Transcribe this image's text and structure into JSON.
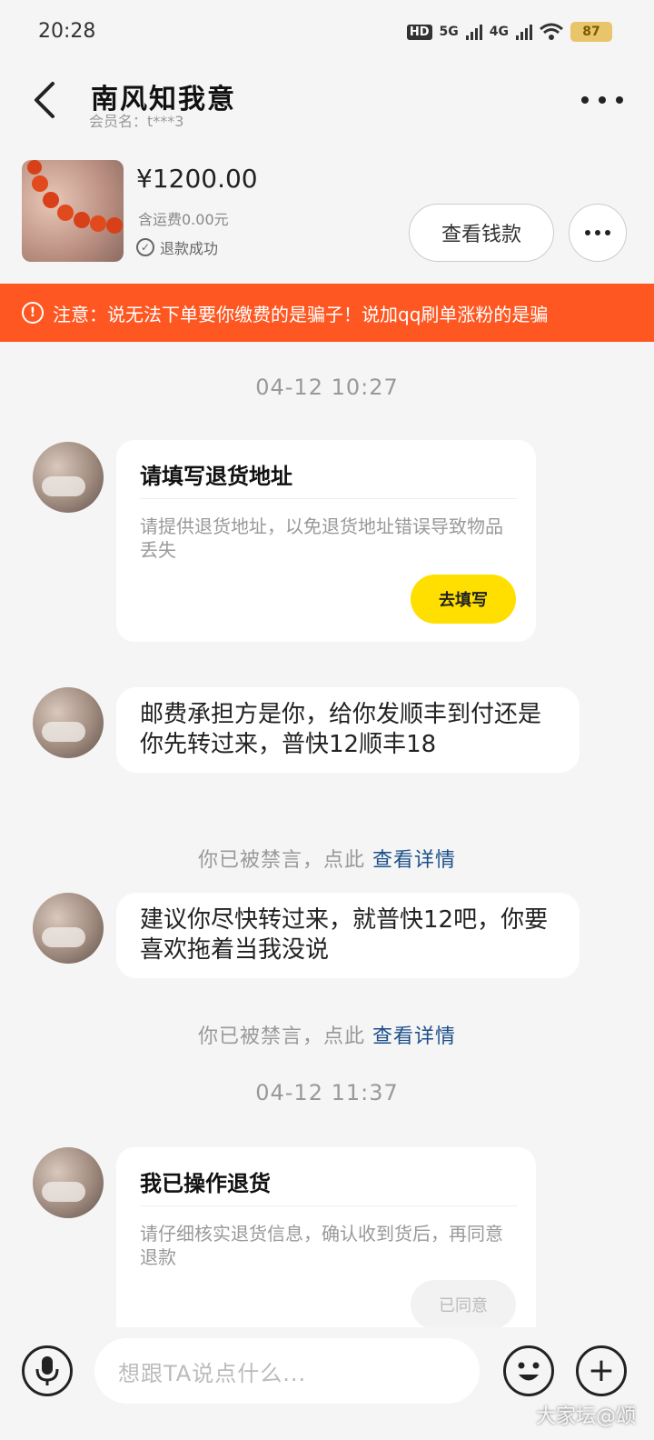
{
  "status_bar": {
    "time": "20:28",
    "hd": "HD",
    "net1": "5G",
    "net2": "4G",
    "battery": "87"
  },
  "header": {
    "title": "南风知我意",
    "member": "会员名：t***3"
  },
  "order": {
    "price": "¥1200.00",
    "shipping": "含运费0.00元",
    "status": "退款成功",
    "view_money_label": "查看钱款"
  },
  "warning": {
    "text": "注意：说无法下单要你缴费的是骗子！说加qq刷单涨粉的是骗"
  },
  "messages": {
    "time1": "04-12 10:27",
    "card1": {
      "title": "请填写退货地址",
      "desc": "请提供退货地址，以免退货地址错误导致物品丢失",
      "button": "去填写"
    },
    "msg1": "邮费承担方是你，给你发顺丰到付还是你先转过来，普快12顺丰18",
    "muted1": {
      "text": "你已被禁言，点此",
      "link": "查看详情"
    },
    "msg2": "建议你尽快转过来，就普快12吧，你要喜欢拖着当我没说",
    "muted2": {
      "text": "你已被禁言，点此",
      "link": "查看详情"
    },
    "time2": "04-12 11:37",
    "card2": {
      "title": "我已操作退货",
      "desc": "请仔细核实退货信息，确认收到货后，再同意退款",
      "button": "已同意"
    }
  },
  "input": {
    "placeholder": "想跟TA说点什么..."
  },
  "watermark": "大家坛@颂",
  "colors": {
    "warning_bg": "#fe5722",
    "button_yellow": "#ffdf00",
    "link_blue": "#1b4f8a"
  }
}
